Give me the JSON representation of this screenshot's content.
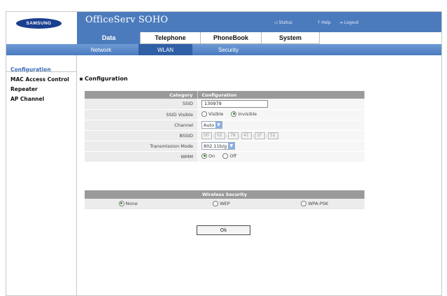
{
  "brand": {
    "logo_text": "SAMSUNG"
  },
  "app": {
    "title": "OfficeServ SOHO"
  },
  "util_links": [
    {
      "icon": "status-icon",
      "label": "Status"
    },
    {
      "icon": "help-icon",
      "label": "Help"
    },
    {
      "icon": "logout-icon",
      "label": "Logout"
    }
  ],
  "main_tabs": [
    {
      "label": "Data",
      "active": true
    },
    {
      "label": "Telephone",
      "active": false
    },
    {
      "label": "PhoneBook",
      "active": false
    },
    {
      "label": "System",
      "active": false
    }
  ],
  "sub_tabs": [
    {
      "label": "Network",
      "active": false
    },
    {
      "label": "WLAN",
      "active": true
    },
    {
      "label": "Security",
      "active": false
    }
  ],
  "left_nav": [
    {
      "label": "Configuration",
      "active": true
    },
    {
      "label": "MAC Access Control",
      "active": false
    },
    {
      "label": "Repeater",
      "active": false
    },
    {
      "label": "AP Channel",
      "active": false
    }
  ],
  "section": {
    "title": "Configuration"
  },
  "config_table": {
    "header_category": "Category",
    "header_configuration": "Configuration",
    "ssid_label": "SSID",
    "ssid_value": "130979",
    "ssid_visible_label": "SSID Visible",
    "ssid_visible_options": [
      "Visible",
      "Invisible"
    ],
    "ssid_visible_selected": "Invisible",
    "channel_label": "Channel",
    "channel_value": "Auto",
    "bssid_label": "BSSID",
    "bssid_segments": [
      "00",
      "02",
      "78",
      "41",
      "1F",
      "52"
    ],
    "mode_label": "Transmission Mode",
    "mode_value": "802.11b/g",
    "wmm_label": "WMM",
    "wmm_options": [
      "On",
      "Off"
    ],
    "wmm_selected": "On"
  },
  "security_table": {
    "header": "Wireless Security",
    "options": [
      "None",
      "WEP",
      "WPA-PSK"
    ],
    "selected": "None"
  },
  "ok_button": {
    "label": "Ok"
  },
  "colors": {
    "header_blue": "#4c7bbd",
    "nav_active": "#3b6db5",
    "table_header_gray": "#9a9a9a"
  }
}
